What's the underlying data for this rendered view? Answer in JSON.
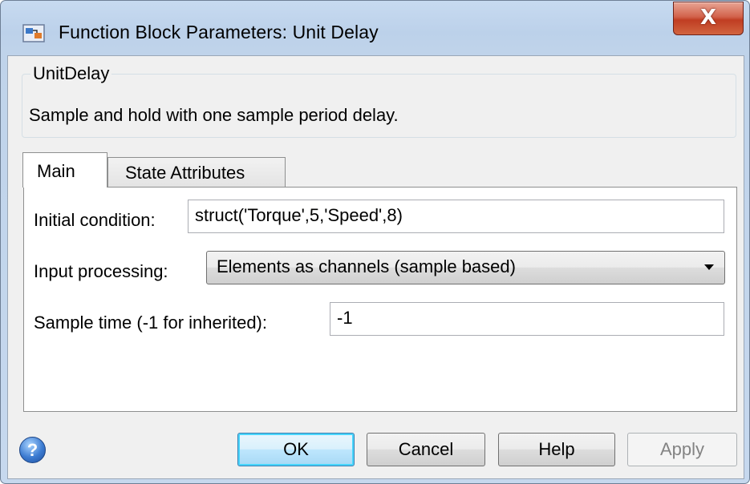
{
  "window": {
    "title": "Function Block Parameters: Unit Delay",
    "close_label": "X"
  },
  "group": {
    "legend": "UnitDelay",
    "description": "Sample and hold with one sample period delay."
  },
  "tabs": [
    {
      "label": "Main",
      "selected": true
    },
    {
      "label": "State Attributes",
      "selected": false
    }
  ],
  "params": {
    "initial_condition": {
      "label": "Initial condition:",
      "value": "struct('Torque',5,'Speed',8)"
    },
    "input_processing": {
      "label": "Input processing:",
      "value": "Elements as channels (sample based)"
    },
    "sample_time": {
      "label": "Sample time (-1 for inherited):",
      "value": "-1"
    }
  },
  "buttons": {
    "help_icon": "?",
    "ok": "OK",
    "cancel": "Cancel",
    "help": "Help",
    "apply": "Apply"
  },
  "icons": {
    "app": "simulink-block-icon",
    "help": "help-circle-icon",
    "dropdown": "chevron-down-icon"
  }
}
